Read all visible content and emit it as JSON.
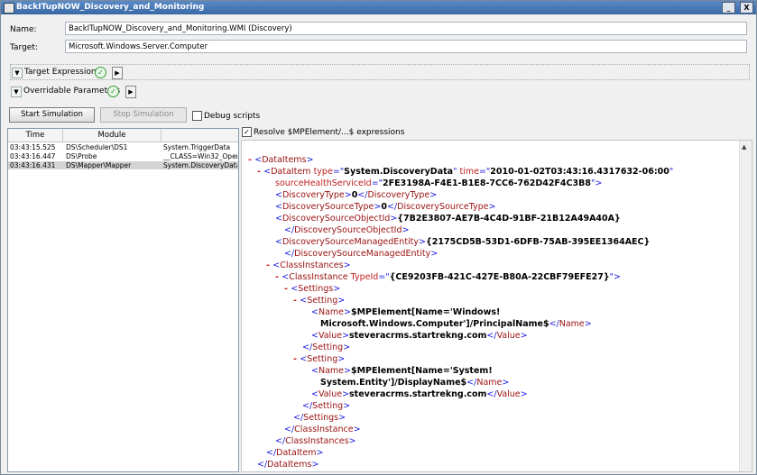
{
  "window": {
    "title": "BackITupNOW_Discovery_and_Monitoring",
    "minimize_label": "_",
    "close_label": "X"
  },
  "form": {
    "name_label": "Name:",
    "name_value": "BackITupNOW_Discovery_and_Monitoring.WMI (Discovery)",
    "target_label": "Target:",
    "target_value": "Microsoft.Windows.Server.Computer"
  },
  "groups": {
    "target_expressions": "Target Expressions",
    "overridable_parameters": "Overridable Parameters"
  },
  "toolbar": {
    "start_label": "Start Simulation",
    "stop_label": "Stop Simulation",
    "debug_label": "Debug scripts",
    "resolve_label": "Resolve $MPElement/...$ expressions"
  },
  "list": {
    "headers": [
      "Time",
      "Module",
      ""
    ],
    "rows": [
      {
        "time": "03:43:15.525",
        "module": "DS\\Scheduler\\DS1",
        "type": "System.TriggerData"
      },
      {
        "time": "03:43:16.447",
        "module": "DS\\Probe",
        "type": "__CLASS=Win32_Oper"
      },
      {
        "time": "03:43:16.431",
        "module": "DS\\Mapper\\Mapper",
        "type": "System.DiscoveryData"
      }
    ]
  },
  "xml": {
    "dataitems": "DataItems",
    "dataitem": "DataItem",
    "attr_type": "type",
    "val_type": "System.DiscoveryData",
    "attr_time": "time",
    "val_time": "2010-01-02T03:43:16.4317632-06:00",
    "attr_shsid": "sourceHealthServiceId",
    "val_shsid": "2FE3198A-F4E1-B1E8-7CC6-762D42F4C3B8",
    "discoverytype": "DiscoveryType",
    "discoverytype_val": "0",
    "discoverysourcetype": "DiscoverySourceType",
    "discoverysourcetype_val": "0",
    "discoverysourceobjectid": "DiscoverySourceObjectId",
    "discoverysourceobjectid_val": "{7B2E3807-AE7B-4C4D-91BF-21B12A49A40A}",
    "discoverysourcemanagedentity": "DiscoverySourceManagedEntity",
    "discoverysourcemanagedentity_val": "{2175CD5B-53D1-6DFB-75AB-395EE1364AEC}",
    "classinstances": "ClassInstances",
    "classinstance": "ClassInstance",
    "attr_typeid": "TypeId",
    "val_typeid": "{CE9203FB-421C-427E-B80A-22CBF79EFE27}",
    "settings": "Settings",
    "setting": "Setting",
    "name": "Name",
    "value": "Value",
    "name1_line1": "$MPElement[Name='Windows!",
    "name1_line2": "Microsoft.Windows.Computer']/PrincipalName$",
    "value1": "steveracrms.startrekng.com",
    "name2_line1": "$MPElement[Name='System!",
    "name2_line2": "System.Entity']/DisplayName$",
    "value2": "steveracrms.startrekng.com"
  }
}
